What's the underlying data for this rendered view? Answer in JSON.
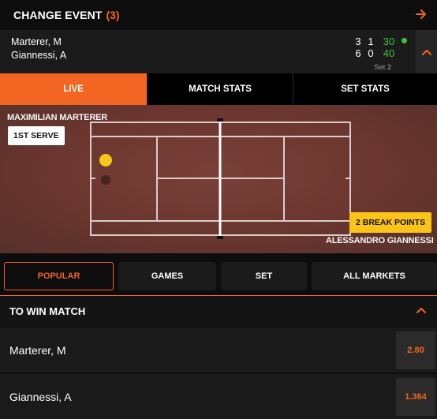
{
  "change_event": {
    "label": "CHANGE EVENT",
    "count": "(3)",
    "icon": "arrow-right-icon"
  },
  "scoreboard": {
    "players": [
      {
        "name": "Marterer, M",
        "sets": "3",
        "games": "1",
        "points": "30",
        "serving": true
      },
      {
        "name": "Giannessi, A",
        "sets": "6",
        "games": "0",
        "points": "40",
        "serving": false
      }
    ],
    "set_label": "Set 2",
    "collapse_icon": "chevron-up-icon"
  },
  "view_tabs": [
    {
      "label": "LIVE",
      "active": true
    },
    {
      "label": "MATCH STATS",
      "active": false
    },
    {
      "label": "SET STATS",
      "active": false
    }
  ],
  "court": {
    "top_player": "MAXIMILIAN MARTERER",
    "bottom_player": "ALESSANDRO GIANNESSI",
    "serve_badge": "1ST SERVE",
    "break_badge": "2 BREAK POINTS"
  },
  "market_tabs": [
    {
      "label": "POPULAR",
      "active": true
    },
    {
      "label": "GAMES",
      "active": false
    },
    {
      "label": "SET",
      "active": false
    },
    {
      "label": "ALL MARKETS",
      "active": false
    }
  ],
  "market": {
    "title": "TO WIN MATCH",
    "icon": "chevron-up-icon",
    "selections": [
      {
        "name": "Marterer, M",
        "odds": "2.80"
      },
      {
        "name": "Giannessi, A",
        "odds": "1.364"
      }
    ]
  },
  "colors": {
    "accent": "#f26522",
    "score_green": "#3ec43e",
    "court_clay": "#6a362f",
    "badge_yellow": "#fcc418"
  }
}
